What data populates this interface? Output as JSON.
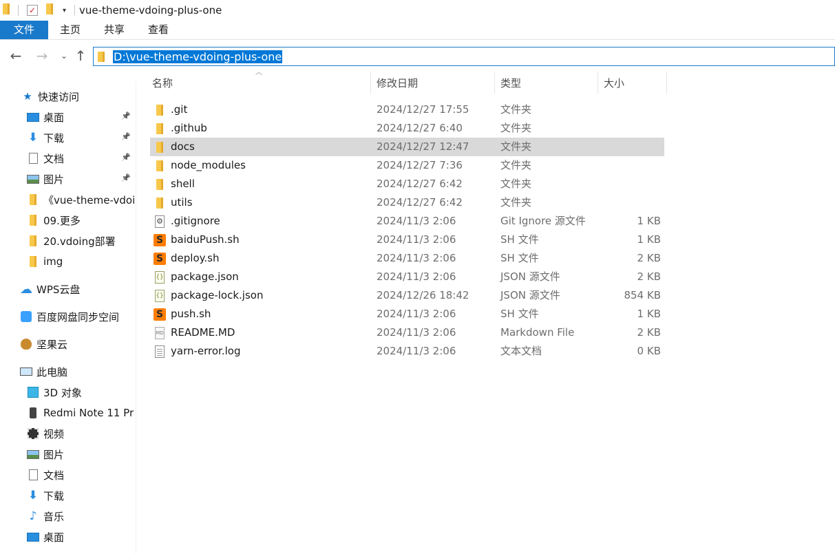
{
  "window": {
    "title": "vue-theme-vdoing-plus-one"
  },
  "ribbon": {
    "tabs": [
      "文件",
      "主页",
      "共享",
      "查看"
    ]
  },
  "address": {
    "path": "D:\\vue-theme-vdoing-plus-one"
  },
  "columns": {
    "name": "名称",
    "date": "修改日期",
    "type": "类型",
    "size": "大小"
  },
  "sidebar": {
    "items": [
      {
        "label": "快速访问",
        "icon": "star-icon"
      },
      {
        "label": "桌面",
        "icon": "desktop-icon",
        "pinned": true
      },
      {
        "label": "下载",
        "icon": "download-icon",
        "pinned": true
      },
      {
        "label": "文档",
        "icon": "document-icon",
        "pinned": true
      },
      {
        "label": "图片",
        "icon": "picture-icon",
        "pinned": true
      },
      {
        "label": "《vue-theme-vdoi",
        "icon": "folder-icon"
      },
      {
        "label": "09.更多",
        "icon": "folder-icon"
      },
      {
        "label": "20.vdoing部署",
        "icon": "folder-icon"
      },
      {
        "label": "img",
        "icon": "folder-icon"
      },
      {
        "label": "WPS云盘",
        "icon": "cloud-icon"
      },
      {
        "label": "百度网盘同步空间",
        "icon": "baidu-netdisk-icon"
      },
      {
        "label": "坚果云",
        "icon": "nut-icon"
      },
      {
        "label": "此电脑",
        "icon": "computer-icon"
      },
      {
        "label": "3D 对象",
        "icon": "cube-icon"
      },
      {
        "label": "Redmi Note 11 Pr",
        "icon": "phone-icon"
      },
      {
        "label": "视频",
        "icon": "video-icon"
      },
      {
        "label": "图片",
        "icon": "picture-icon"
      },
      {
        "label": "文档",
        "icon": "document-icon"
      },
      {
        "label": "下载",
        "icon": "download-icon"
      },
      {
        "label": "音乐",
        "icon": "music-icon"
      },
      {
        "label": "桌面",
        "icon": "desktop-icon"
      }
    ]
  },
  "files": [
    {
      "name": ".git",
      "date": "2024/12/27 17:55",
      "type": "文件夹",
      "size": "",
      "icon": "folder"
    },
    {
      "name": ".github",
      "date": "2024/12/27 6:40",
      "type": "文件夹",
      "size": "",
      "icon": "folder"
    },
    {
      "name": "docs",
      "date": "2024/12/27 12:47",
      "type": "文件夹",
      "size": "",
      "icon": "folder",
      "selected": true
    },
    {
      "name": "node_modules",
      "date": "2024/12/27 7:36",
      "type": "文件夹",
      "size": "",
      "icon": "folder"
    },
    {
      "name": "shell",
      "date": "2024/12/27 6:42",
      "type": "文件夹",
      "size": "",
      "icon": "folder"
    },
    {
      "name": "utils",
      "date": "2024/12/27 6:42",
      "type": "文件夹",
      "size": "",
      "icon": "folder"
    },
    {
      "name": ".gitignore",
      "date": "2024/11/3 2:06",
      "type": "Git Ignore 源文件",
      "size": "1 KB",
      "icon": "gear-doc"
    },
    {
      "name": "baiduPush.sh",
      "date": "2024/11/3 2:06",
      "type": "SH 文件",
      "size": "1 KB",
      "icon": "sh"
    },
    {
      "name": "deploy.sh",
      "date": "2024/11/3 2:06",
      "type": "SH 文件",
      "size": "2 KB",
      "icon": "sh"
    },
    {
      "name": "package.json",
      "date": "2024/11/3 2:06",
      "type": "JSON 源文件",
      "size": "2 KB",
      "icon": "json"
    },
    {
      "name": "package-lock.json",
      "date": "2024/12/26 18:42",
      "type": "JSON 源文件",
      "size": "854 KB",
      "icon": "json"
    },
    {
      "name": "push.sh",
      "date": "2024/11/3 2:06",
      "type": "SH 文件",
      "size": "1 KB",
      "icon": "sh"
    },
    {
      "name": "README.MD",
      "date": "2024/11/3 2:06",
      "type": "Markdown File",
      "size": "2 KB",
      "icon": "md"
    },
    {
      "name": "yarn-error.log",
      "date": "2024/11/3 2:06",
      "type": "文本文档",
      "size": "0 KB",
      "icon": "text"
    }
  ]
}
